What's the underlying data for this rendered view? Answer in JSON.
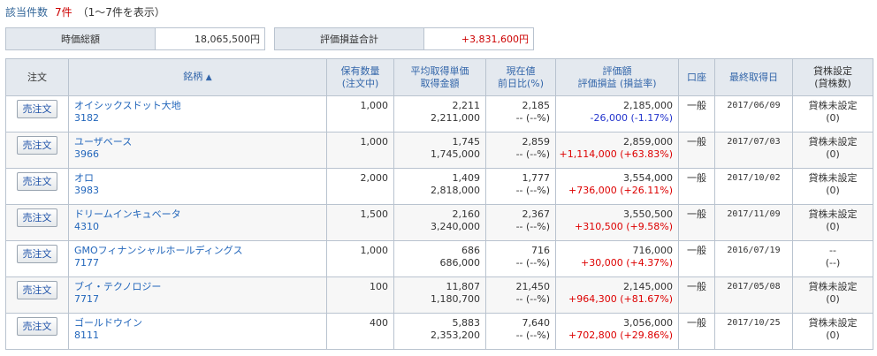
{
  "count": {
    "label": "該当件数",
    "value": "7件",
    "range": "（1〜7件を表示）"
  },
  "summary": {
    "market_label": "時価総額",
    "market_value": "18,065,500円",
    "pl_label": "評価損益合計",
    "pl_value": "+3,831,600円"
  },
  "headers": {
    "order": "注文",
    "name": "銘柄",
    "name_sort": "▲",
    "qty_1": "保有数量",
    "qty_2": "(注文中)",
    "avg_1": "平均取得単価",
    "avg_2": "取得金額",
    "price_1": "現在値",
    "price_2": "前日比(%)",
    "val_1": "評価額",
    "val_2": "評価損益 (損益率)",
    "acct": "口座",
    "date": "最終取得日",
    "lend_1": "貸株設定",
    "lend_2": "(貸株数)"
  },
  "sell_label": "売注文",
  "rows": [
    {
      "name": "オイシックスドット大地",
      "code": "3182",
      "qty": "1,000",
      "avg_price": "2,211",
      "cost": "2,211,000",
      "price": "2,185",
      "change": "-- (--%)",
      "value": "2,185,000",
      "pl": "-26,000 (-1.17%)",
      "pl_sign": "neg",
      "account": "一般",
      "date": "2017/06/09",
      "lend": "貸株未設定",
      "lend_qty": "(0)"
    },
    {
      "name": "ユーザベース",
      "code": "3966",
      "qty": "1,000",
      "avg_price": "1,745",
      "cost": "1,745,000",
      "price": "2,859",
      "change": "-- (--%)",
      "value": "2,859,000",
      "pl": "+1,114,000 (+63.83%)",
      "pl_sign": "pos",
      "account": "一般",
      "date": "2017/07/03",
      "lend": "貸株未設定",
      "lend_qty": "(0)"
    },
    {
      "name": "オロ",
      "code": "3983",
      "qty": "2,000",
      "avg_price": "1,409",
      "cost": "2,818,000",
      "price": "1,777",
      "change": "-- (--%)",
      "value": "3,554,000",
      "pl": "+736,000 (+26.11%)",
      "pl_sign": "pos",
      "account": "一般",
      "date": "2017/10/02",
      "lend": "貸株未設定",
      "lend_qty": "(0)"
    },
    {
      "name": "ドリームインキュベータ",
      "code": "4310",
      "qty": "1,500",
      "avg_price": "2,160",
      "cost": "3,240,000",
      "price": "2,367",
      "change": "-- (--%)",
      "value": "3,550,500",
      "pl": "+310,500 (+9.58%)",
      "pl_sign": "pos",
      "account": "一般",
      "date": "2017/11/09",
      "lend": "貸株未設定",
      "lend_qty": "(0)"
    },
    {
      "name": "GMOフィナンシャルホールディングス",
      "code": "7177",
      "qty": "1,000",
      "avg_price": "686",
      "cost": "686,000",
      "price": "716",
      "change": "-- (--%)",
      "value": "716,000",
      "pl": "+30,000 (+4.37%)",
      "pl_sign": "pos",
      "account": "一般",
      "date": "2016/07/19",
      "lend": "--",
      "lend_qty": "(--)"
    },
    {
      "name": "ブイ・テクノロジー",
      "code": "7717",
      "qty": "100",
      "avg_price": "11,807",
      "cost": "1,180,700",
      "price": "21,450",
      "change": "-- (--%)",
      "value": "2,145,000",
      "pl": "+964,300 (+81.67%)",
      "pl_sign": "pos",
      "account": "一般",
      "date": "2017/05/08",
      "lend": "貸株未設定",
      "lend_qty": "(0)"
    },
    {
      "name": "ゴールドウイン",
      "code": "8111",
      "qty": "400",
      "avg_price": "5,883",
      "cost": "2,353,200",
      "price": "7,640",
      "change": "-- (--%)",
      "value": "3,056,000",
      "pl": "+702,800 (+29.86%)",
      "pl_sign": "pos",
      "account": "一般",
      "date": "2017/10/25",
      "lend": "貸株未設定",
      "lend_qty": "(0)"
    }
  ]
}
